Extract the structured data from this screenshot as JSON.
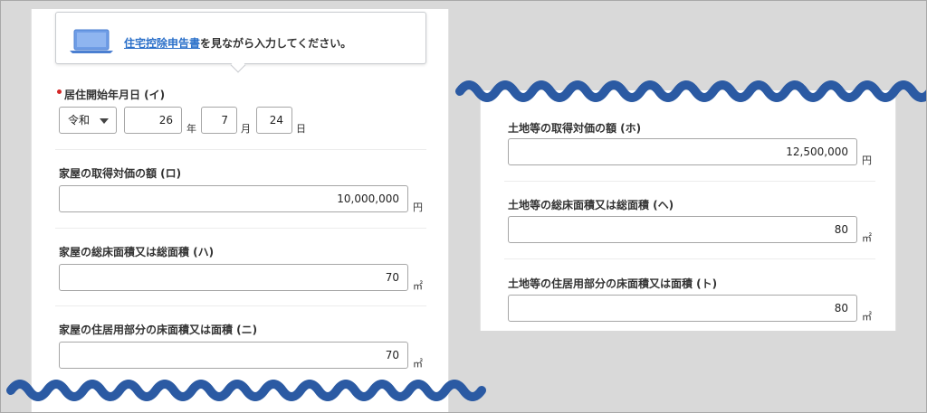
{
  "tip": {
    "link_text": "住宅控除申告書",
    "rest_text": "を見ながら入力してください。"
  },
  "left": {
    "move_in_date": {
      "label": "居住開始年月日 (イ)",
      "era": "令和",
      "year": "26",
      "year_unit": "年",
      "month": "7",
      "month_unit": "月",
      "day": "24",
      "day_unit": "日"
    },
    "house_price": {
      "label": "家屋の取得対価の額 (ロ)",
      "value": "10,000,000",
      "unit": "円"
    },
    "house_total_area": {
      "label": "家屋の総床面積又は総面積 (ハ)",
      "value": "70",
      "unit": "㎡"
    },
    "house_residential_area": {
      "label": "家屋の住居用部分の床面積又は面積 (ニ)",
      "value": "70",
      "unit": "㎡"
    }
  },
  "right": {
    "land_price": {
      "label": "土地等の取得対価の額 (ホ)",
      "value": "12,500,000",
      "unit": "円"
    },
    "land_total_area": {
      "label": "土地等の総床面積又は総面積 (ヘ)",
      "value": "80",
      "unit": "㎡"
    },
    "land_residential_area": {
      "label": "土地等の住居用部分の床面積又は面積 (ト)",
      "value": "80",
      "unit": "㎡"
    }
  },
  "colors": {
    "wave": "#2b5aa3",
    "link": "#2a6fc9",
    "required": "#d42727"
  }
}
